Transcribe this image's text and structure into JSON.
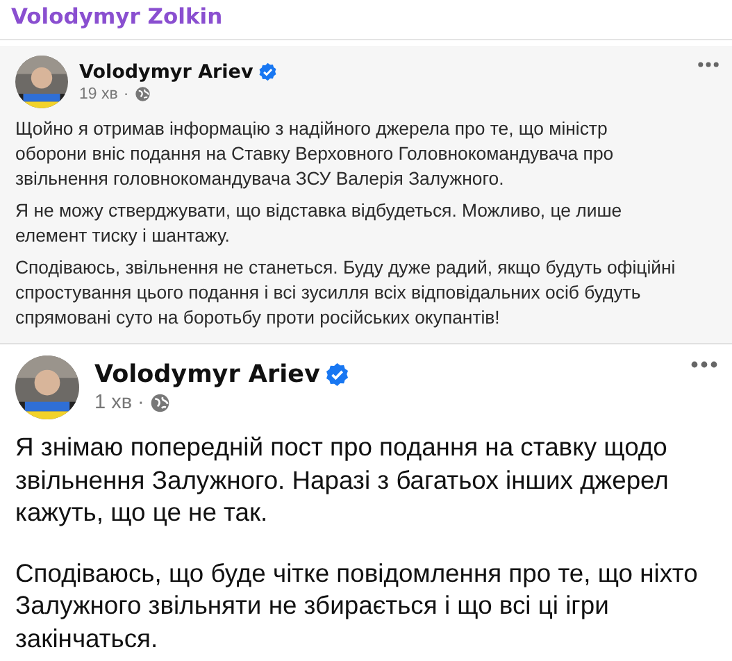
{
  "sender": {
    "name": "Volodymyr Zolkin"
  },
  "posts": [
    {
      "kind": "compact",
      "author": "Volodymyr Ariev",
      "verified": true,
      "time": "19 хв",
      "separator": "·",
      "paragraphs": [
        "Щойно я отримав інформацію з надійного джерела про те, що міністр оборони вніс подання на Ставку Верховного Головнокомандувача про звільнення головнокомандувача ЗСУ Валерія Залужного.",
        "Я не можу стверджувати, що відставка відбудеться. Можливо, це лише елемент тиску і шантажу.",
        "Сподіваюсь, звільнення не станеться. Буду дуже радий, якщо будуть офіційні спростування цього подання і всі зусилля всіх відповідальних осіб будуть спрямовані суто на боротьбу проти російських окупантів!"
      ]
    },
    {
      "kind": "large",
      "author": "Volodymyr Ariev",
      "verified": true,
      "time": "1 хв",
      "separator": "·",
      "paragraphs": [
        "Я знімаю попередній пост про подання на ставку щодо звільнення Залужного. Наразі з багатьох інших джерел кажуть, що це не так.",
        "Сподіваюсь, що буде чітке повідомлення про те, що ніхто Залужного звільняти не збирається і що всі ці ігри закінчаться."
      ]
    }
  ]
}
